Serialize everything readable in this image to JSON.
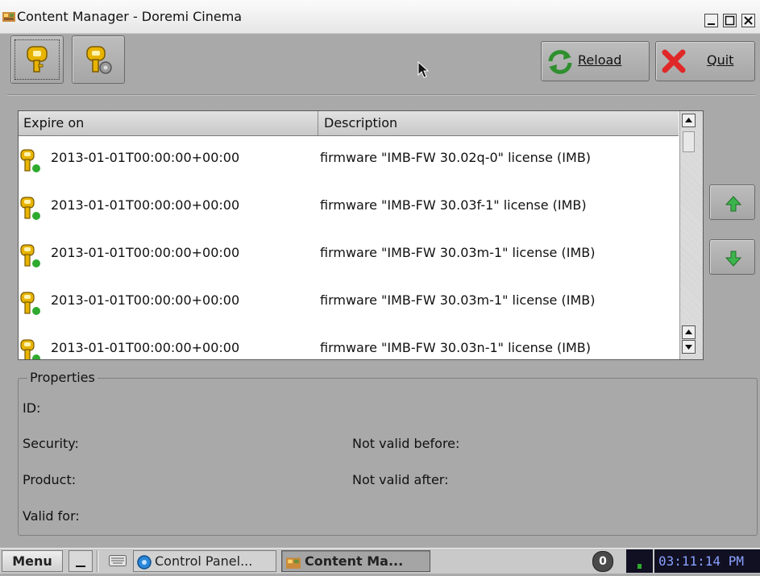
{
  "window": {
    "title": "Content Manager - Doremi Cinema"
  },
  "toolbar": {
    "reload_label": "Reload",
    "quit_label": "Quit"
  },
  "list": {
    "columns": [
      "Expire on",
      "Description"
    ],
    "rows": [
      {
        "expire": "2013-01-01T00:00:00+00:00",
        "description": "firmware \"IMB-FW  30.02q-0\" license (IMB)"
      },
      {
        "expire": "2013-01-01T00:00:00+00:00",
        "description": "firmware \"IMB-FW  30.03f-1\" license (IMB)"
      },
      {
        "expire": "2013-01-01T00:00:00+00:00",
        "description": "firmware \"IMB-FW  30.03m-1\" license (IMB)"
      },
      {
        "expire": "2013-01-01T00:00:00+00:00",
        "description": "firmware \"IMB-FW  30.03m-1\" license (IMB)"
      },
      {
        "expire": "2013-01-01T00:00:00+00:00",
        "description": "firmware \"IMB-FW  30.03n-1\" license (IMB)"
      }
    ]
  },
  "properties": {
    "legend": "Properties",
    "id_label": "ID:",
    "security_label": "Security:",
    "product_label": "Product:",
    "valid_for_label": "Valid for:",
    "not_valid_before_label": "Not valid before:",
    "not_valid_after_label": "Not valid after:"
  },
  "taskbar": {
    "menu_label": "Menu",
    "tasks": [
      "Control Panel...",
      "Content Ma..."
    ],
    "notification_count": "0",
    "clock": "03:11:14 PM"
  },
  "icons": {
    "license_key": "key-green-dot-icon",
    "toolbar_key": "key-icon",
    "toolbar_key_settings": "key-settings-icon",
    "reload": "reload-icon",
    "quit": "red-x-icon",
    "move_up": "arrow-up-icon",
    "move_down": "arrow-down-icon"
  },
  "colors": {
    "key_gold": "#e0a800",
    "status_green": "#2eaa2e",
    "quit_red": "#e03030",
    "reload_green": "#3a9a3a"
  }
}
